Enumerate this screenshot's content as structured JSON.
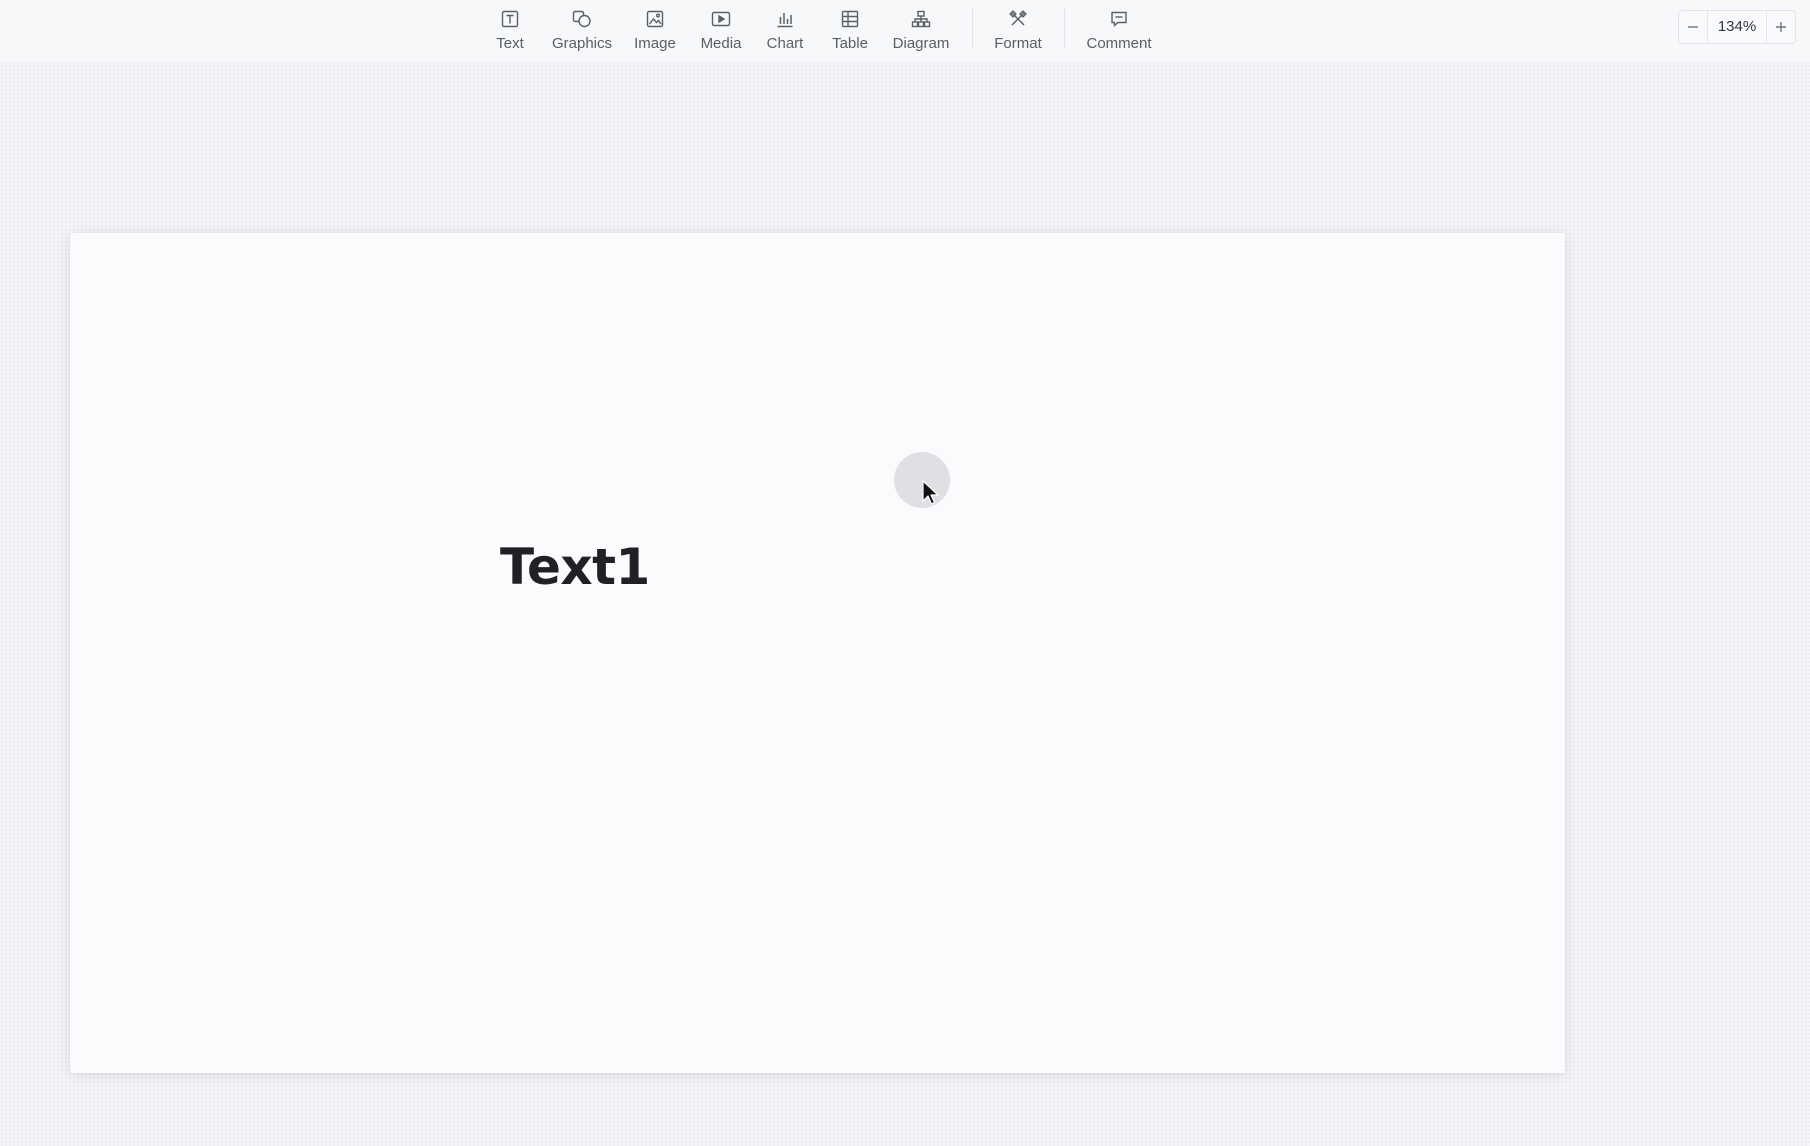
{
  "toolbar": {
    "items": [
      {
        "label": "Text",
        "icon": "text-box-icon"
      },
      {
        "label": "Graphics",
        "icon": "shapes-icon"
      },
      {
        "label": "Image",
        "icon": "image-icon"
      },
      {
        "label": "Media",
        "icon": "media-play-icon"
      },
      {
        "label": "Chart",
        "icon": "bar-chart-icon"
      },
      {
        "label": "Table",
        "icon": "table-icon"
      },
      {
        "label": "Diagram",
        "icon": "diagram-icon"
      },
      {
        "label": "Format",
        "icon": "format-brush-icon"
      },
      {
        "label": "Comment",
        "icon": "comment-icon"
      }
    ]
  },
  "zoom": {
    "value": "134%",
    "minus_icon": "minus-icon",
    "plus_icon": "plus-icon"
  },
  "slide": {
    "textbox": "Text1"
  },
  "colors": {
    "canvas": "#f4f5f7",
    "slide": "#fbfbfd",
    "text": "#1f2124",
    "icon": "#5c5f66"
  }
}
